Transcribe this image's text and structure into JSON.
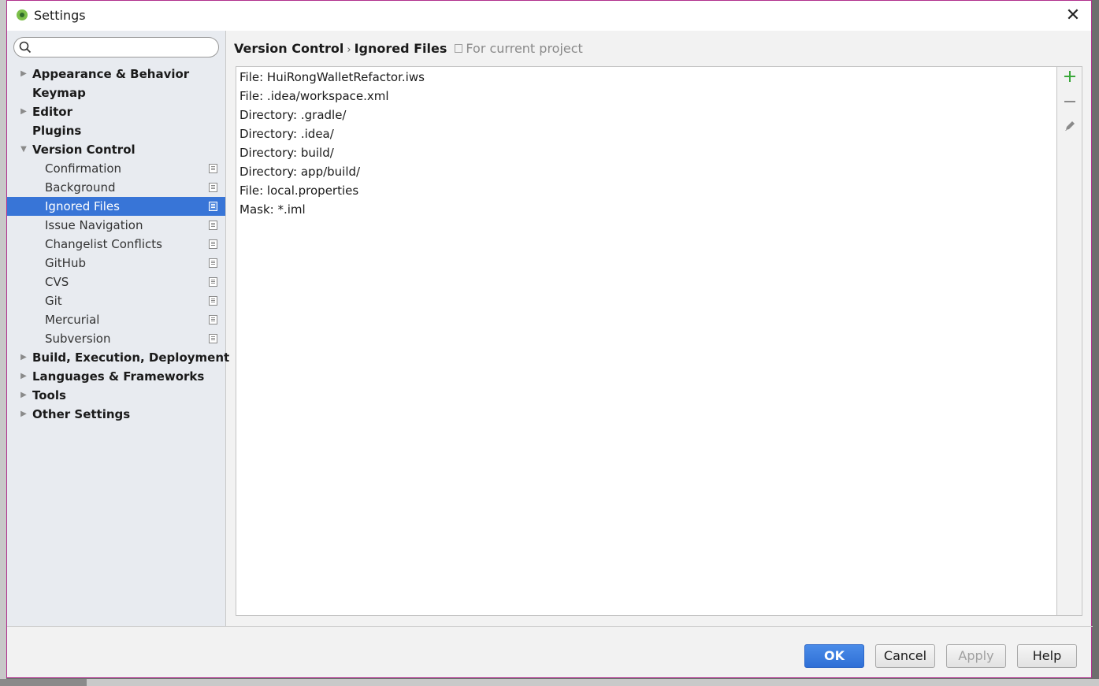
{
  "window": {
    "title": "Settings"
  },
  "search": {
    "placeholder": "",
    "value": ""
  },
  "sidebar": {
    "items": [
      {
        "label": "Appearance & Behavior",
        "level": 0,
        "arrow": "collapsed"
      },
      {
        "label": "Keymap",
        "level": 0,
        "arrow": "none"
      },
      {
        "label": "Editor",
        "level": 0,
        "arrow": "collapsed"
      },
      {
        "label": "Plugins",
        "level": 0,
        "arrow": "none"
      },
      {
        "label": "Version Control",
        "level": 0,
        "arrow": "expanded"
      },
      {
        "label": "Confirmation",
        "level": 1,
        "project_icon": true
      },
      {
        "label": "Background",
        "level": 1,
        "project_icon": true
      },
      {
        "label": "Ignored Files",
        "level": 1,
        "project_icon": true,
        "selected": true
      },
      {
        "label": "Issue Navigation",
        "level": 1,
        "project_icon": true
      },
      {
        "label": "Changelist Conflicts",
        "level": 1,
        "project_icon": true
      },
      {
        "label": "GitHub",
        "level": 1,
        "project_icon": true
      },
      {
        "label": "CVS",
        "level": 1,
        "project_icon": true
      },
      {
        "label": "Git",
        "level": 1,
        "project_icon": true
      },
      {
        "label": "Mercurial",
        "level": 1,
        "project_icon": true
      },
      {
        "label": "Subversion",
        "level": 1,
        "project_icon": true
      },
      {
        "label": "Build, Execution, Deployment",
        "level": 0,
        "arrow": "collapsed"
      },
      {
        "label": "Languages & Frameworks",
        "level": 0,
        "arrow": "collapsed"
      },
      {
        "label": "Tools",
        "level": 0,
        "arrow": "collapsed"
      },
      {
        "label": "Other Settings",
        "level": 0,
        "arrow": "collapsed"
      }
    ]
  },
  "breadcrumb": {
    "parent": "Version Control",
    "separator": "›",
    "current": "Ignored Files",
    "scope": "For current project"
  },
  "ignored_files": [
    "File: HuiRongWalletRefactor.iws",
    "File: .idea/workspace.xml",
    "Directory: .gradle/",
    "Directory: .idea/",
    "Directory: build/",
    "Directory: app/build/",
    "File: local.properties",
    "Mask: *.iml"
  ],
  "toolbar": {
    "icons": [
      "add-icon",
      "remove-icon",
      "edit-icon"
    ],
    "add_color": "#3aa83a"
  },
  "footer": {
    "ok": "OK",
    "cancel": "Cancel",
    "apply": "Apply",
    "help": "Help"
  },
  "colors": {
    "selection": "#3875d7",
    "sidebar_bg": "#e8ebf0",
    "window_border": "#b0308d"
  }
}
